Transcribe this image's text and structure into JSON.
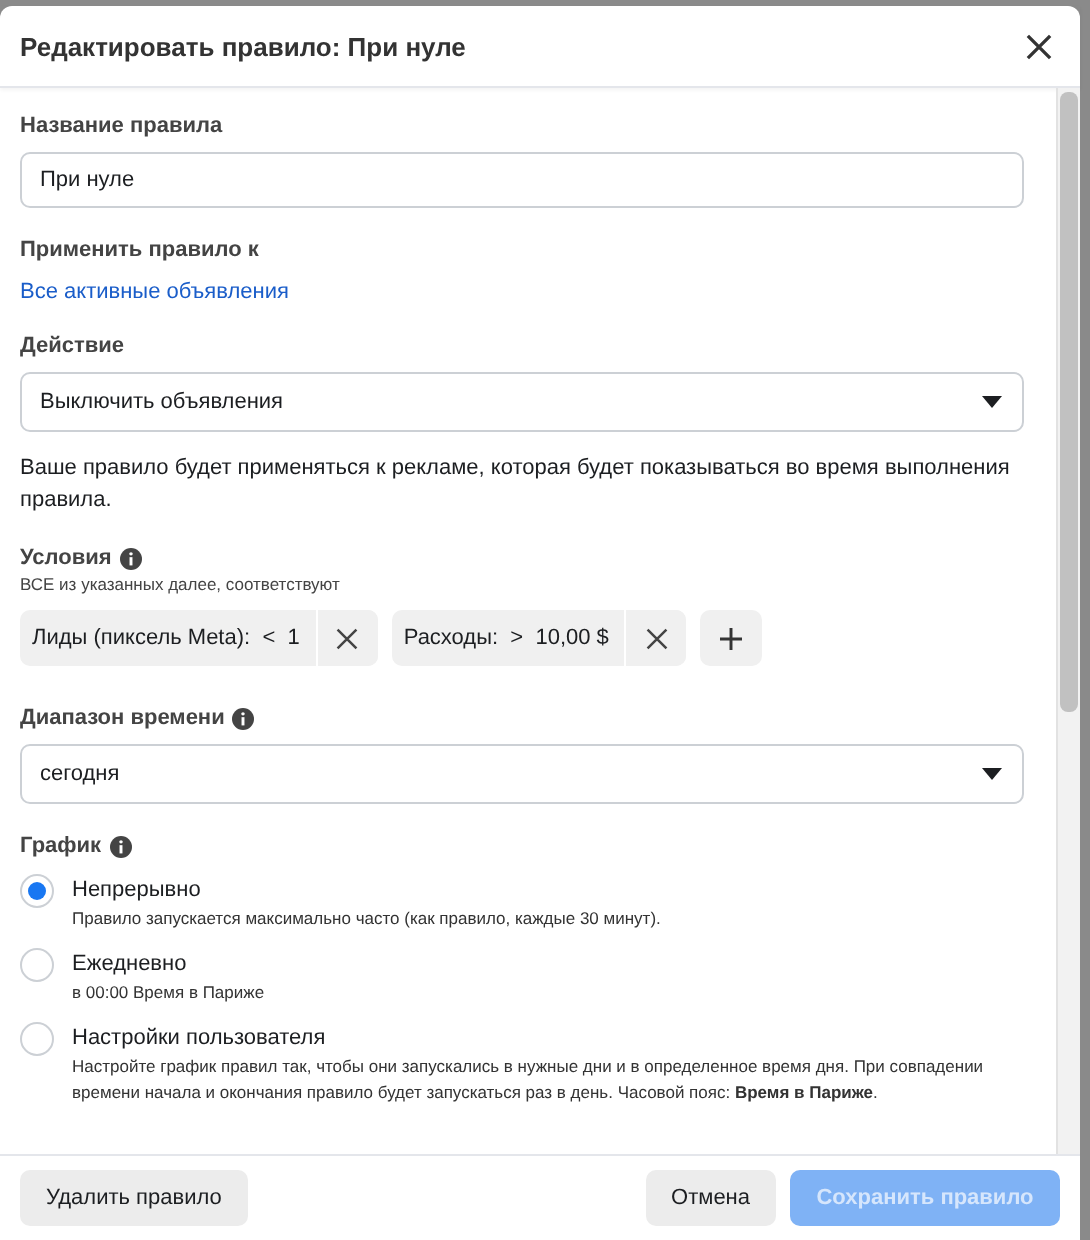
{
  "dialog": {
    "title": "Редактировать правило: При нуле"
  },
  "rule_name": {
    "label": "Название правила",
    "value": "При нуле"
  },
  "apply_to": {
    "label": "Применить правило к",
    "link": "Все активные объявления"
  },
  "action": {
    "label": "Действие",
    "value": "Выключить объявления",
    "note": "Ваше правило будет применяться к рекламе, которая будет показываться во время выполнения правила."
  },
  "conditions": {
    "label": "Условия",
    "subtitle": "ВСЕ из указанных далее, соответствуют",
    "items": [
      {
        "metric": "Лиды (пиксель Meta):",
        "operator": "<",
        "value": "1"
      },
      {
        "metric": "Расходы:",
        "operator": ">",
        "value": "10,00 $"
      }
    ]
  },
  "time_range": {
    "label": "Диапазон времени",
    "value": "сегодня"
  },
  "schedule": {
    "label": "График",
    "options": [
      {
        "label": "Непрерывно",
        "description": "Правило запускается максимально часто (как правило, каждые 30 минут).",
        "selected": true
      },
      {
        "label": "Ежедневно",
        "description": "в 00:00 Время в Париже",
        "selected": false
      },
      {
        "label": "Настройки пользователя",
        "description": "Настройте график правил так, чтобы они запускались в нужные дни и в определенное время дня. При совпадении времени начала и окончания правило будет запускаться раз в день. Часовой пояс: **Время в Париже**.",
        "selected": false
      }
    ]
  },
  "footer": {
    "delete": "Удалить правило",
    "cancel": "Отмена",
    "save": {
      "label": "Сохранить правило",
      "disabled": true
    }
  }
}
